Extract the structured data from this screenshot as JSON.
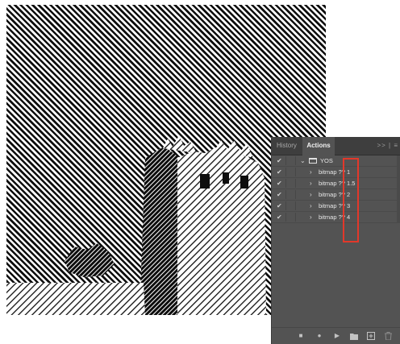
{
  "tabs": {
    "history": "History",
    "actions": "Actions"
  },
  "panel_menu": ">> | ≡",
  "set": {
    "name": "YOS",
    "expanded": true,
    "checked": true
  },
  "actions": [
    {
      "label": "bitmap ?? 1",
      "checked": true
    },
    {
      "label": "bitmap ?? 1.5",
      "checked": true
    },
    {
      "label": "bitmap ?? 2",
      "checked": true
    },
    {
      "label": "bitmap ?? 3",
      "checked": true
    },
    {
      "label": "bitmap ?? 4",
      "checked": true
    }
  ],
  "toolbar": {
    "stop": "■",
    "record": "●",
    "play": "▶",
    "new_set": "folder-icon",
    "new_action": "new-icon",
    "delete": "trash-icon"
  },
  "colors": {
    "panel_bg": "#535353",
    "tab_bg": "#3e3e3e",
    "highlight": "#e2382a"
  }
}
